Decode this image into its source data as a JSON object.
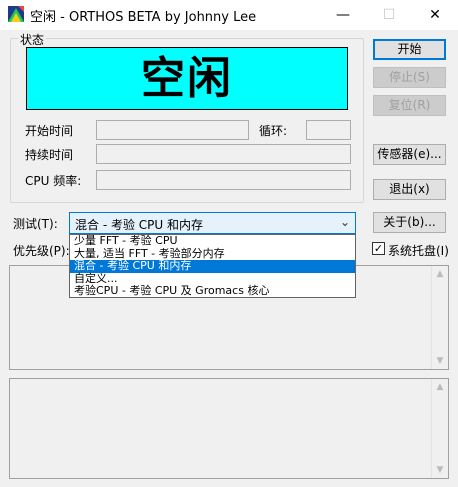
{
  "window": {
    "title": "空闲 - ORTHOS BETA by Johnny Lee",
    "minimize_icon": "minimize-icon",
    "maximize_icon": "maximize-icon",
    "close_icon": "close-icon"
  },
  "status_group": {
    "label": "状态",
    "status_text": "空闲",
    "status_color": "#00ffff",
    "start_time_label": "开始时间",
    "start_time_value": "",
    "loop_label": "循环:",
    "loop_value": "",
    "duration_label": "持续时间",
    "duration_value": "",
    "cpu_freq_label": "CPU 频率:",
    "cpu_freq_value": ""
  },
  "buttons": {
    "start": "开始",
    "stop": "停止(S)",
    "reset": "复位(R)",
    "sensors": "传感器(e)...",
    "exit": "退出(x)",
    "about": "关于(b)..."
  },
  "test": {
    "label": "测试(T):",
    "selected": "混合 - 考验 CPU 和内存",
    "options": [
      "少量 FFT - 考验 CPU",
      "大量, 适当 FFT - 考验部分内存",
      "混合 - 考验 CPU 和内存",
      "自定义...",
      "考验CPU - 考验 CPU 及 Gromacs 核心"
    ],
    "selected_index": 2
  },
  "priority": {
    "label": "优先级(P):"
  },
  "tray": {
    "label": "系统托盘(I)",
    "checked": true
  }
}
